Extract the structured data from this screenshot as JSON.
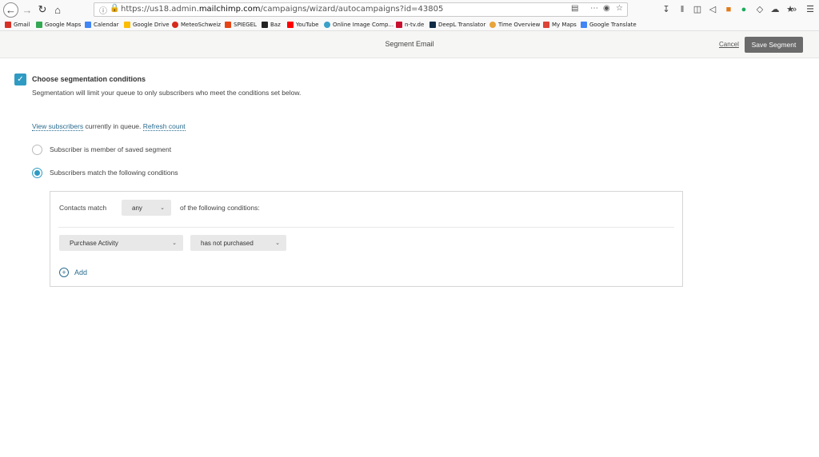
{
  "browser": {
    "url_prefix": "https://us18.admin.",
    "url_domain": "mailchimp.com",
    "url_path": "/campaigns/wizard/autocampaigns?id=43805",
    "bookmarks": [
      {
        "label": "Gmail",
        "color": "#d93025"
      },
      {
        "label": "Google Maps",
        "color": "#34a853"
      },
      {
        "label": "Calendar",
        "color": "#4285f4"
      },
      {
        "label": "Google Drive",
        "color": "#fbbc04"
      },
      {
        "label": "MeteoSchweiz",
        "color": "#d52b1e"
      },
      {
        "label": "SPIEGEL",
        "color": "#e64415"
      },
      {
        "label": "Baz",
        "color": "#222222"
      },
      {
        "label": "YouTube",
        "color": "#ff0000"
      },
      {
        "label": "Online Image Comp...",
        "color": "#3aa0c8"
      },
      {
        "label": "n-tv.de",
        "color": "#c8102e"
      },
      {
        "label": "DeepL Translator",
        "color": "#0f2b46"
      },
      {
        "label": "Time Overview",
        "color": "#e8a33c"
      },
      {
        "label": "My Maps",
        "color": "#db4437"
      },
      {
        "label": "Google Translate",
        "color": "#4285f4"
      }
    ]
  },
  "header": {
    "title": "Segment Email",
    "cancel_label": "Cancel",
    "save_label": "Save Segment"
  },
  "segmentation": {
    "checkbox_label": "Choose segmentation conditions",
    "checked": true,
    "description": "Segmentation will limit your queue to only subscribers who meet the conditions set below.",
    "view_link": "View subscribers",
    "queue_text": " currently in queue. ",
    "refresh_link": "Refresh count",
    "option_saved": "Subscriber is member of saved segment",
    "option_match": "Subscribers match the following conditions",
    "selected_option": "match"
  },
  "conditions": {
    "contacts_match_label": "Contacts match",
    "match_value": "any",
    "of_following_label": "of the following conditions:",
    "field_value": "Purchase Activity",
    "operator_value": "has not purchased",
    "add_label": "Add"
  },
  "colors": {
    "accent": "#2f9bc3",
    "link": "#2a6c8f",
    "save_button": "#6b6b6b"
  }
}
